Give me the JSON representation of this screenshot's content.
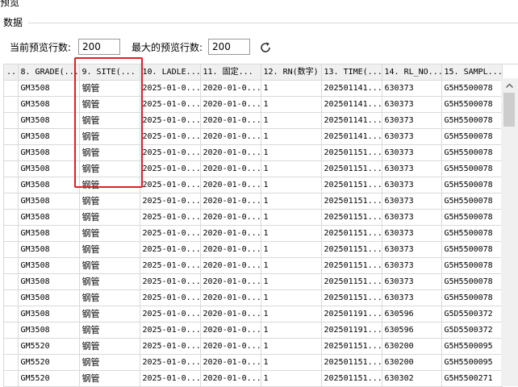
{
  "window": {
    "title": "预览"
  },
  "group": {
    "label": "数据"
  },
  "toolbar": {
    "current_rows_label": "当前预览行数:",
    "current_rows_value": "200",
    "max_rows_label": "最大的预览行数:",
    "max_rows_value": "200",
    "refresh_icon": "refresh-icon"
  },
  "grid": {
    "columns": [
      "...",
      "8. GRADE(...",
      "9. SITE(...",
      "10. LADLE...",
      "11. 固定...",
      "12. RN(数字)",
      "13. TIME(...",
      "14. RL_NO...",
      "15. SAMPL..."
    ],
    "rows": [
      [
        "",
        "GM3508",
        "钢管",
        "2025-01-0...",
        "2020-01-0...",
        "1",
        "202501141...",
        "630373",
        "G5H5500078"
      ],
      [
        "",
        "GM3508",
        "钢管",
        "2025-01-0...",
        "2020-01-0...",
        "1",
        "202501141...",
        "630373",
        "G5H5500078"
      ],
      [
        "",
        "GM3508",
        "钢管",
        "2025-01-0...",
        "2020-01-0...",
        "1",
        "202501141...",
        "630373",
        "G5H5500078"
      ],
      [
        "",
        "GM3508",
        "钢管",
        "2025-01-0...",
        "2020-01-0...",
        "1",
        "202501141...",
        "630373",
        "G5H5500078"
      ],
      [
        "",
        "GM3508",
        "钢管",
        "2025-01-0...",
        "2020-01-0...",
        "1",
        "202501151...",
        "630373",
        "G5H5500078"
      ],
      [
        "",
        "GM3508",
        "钢管",
        "2025-01-0...",
        "2020-01-0...",
        "1",
        "202501151...",
        "630373",
        "G5H5500078"
      ],
      [
        "",
        "GM3508",
        "钢管",
        "2025-01-0...",
        "2020-01-0...",
        "1",
        "202501151...",
        "630373",
        "G5H5500078"
      ],
      [
        "",
        "GM3508",
        "钢管",
        "2025-01-0...",
        "2020-01-0...",
        "1",
        "202501151...",
        "630373",
        "G5H5500078"
      ],
      [
        "",
        "GM3508",
        "钢管",
        "2025-01-0...",
        "2020-01-0...",
        "1",
        "202501151...",
        "630373",
        "G5H5500078"
      ],
      [
        "",
        "GM3508",
        "钢管",
        "2025-01-0...",
        "2020-01-0...",
        "1",
        "202501151...",
        "630373",
        "G5H5500078"
      ],
      [
        "",
        "GM3508",
        "钢管",
        "2025-01-0...",
        "2020-01-0...",
        "1",
        "202501151...",
        "630373",
        "G5H5500078"
      ],
      [
        "",
        "GM3508",
        "钢管",
        "2025-01-0...",
        "2020-01-0...",
        "1",
        "202501151...",
        "630373",
        "G5H5500078"
      ],
      [
        "",
        "GM3508",
        "钢管",
        "2025-01-0...",
        "2020-01-0...",
        "1",
        "202501151...",
        "630373",
        "G5H5500078"
      ],
      [
        "",
        "GM3508",
        "钢管",
        "2025-01-0...",
        "2020-01-0...",
        "1",
        "202501151...",
        "630373",
        "G5H5500078"
      ],
      [
        "",
        "GM3508",
        "钢管",
        "2025-01-0...",
        "2020-01-0...",
        "1",
        "202501191...",
        "630596",
        "G5D5500372"
      ],
      [
        "",
        "GM3508",
        "钢管",
        "2025-01-0...",
        "2020-01-0...",
        "1",
        "202501191...",
        "630596",
        "G5D5500372"
      ],
      [
        "",
        "GM5520",
        "钢管",
        "2025-01-0...",
        "2020-01-0...",
        "1",
        "202501151...",
        "630200",
        "G5H5500095"
      ],
      [
        "",
        "GM5520",
        "钢管",
        "2025-01-0...",
        "2020-01-0...",
        "1",
        "202501151...",
        "630200",
        "G5H5500095"
      ],
      [
        "",
        "GM5520",
        "钢管",
        "2025-01-0...",
        "2020-01-0...",
        "1",
        "202501151...",
        "630302",
        "G5H5500271"
      ]
    ]
  },
  "scrollbar": {
    "up_icon": "scroll-up-arrow-icon"
  },
  "highlight": {
    "color": "#e02020"
  }
}
